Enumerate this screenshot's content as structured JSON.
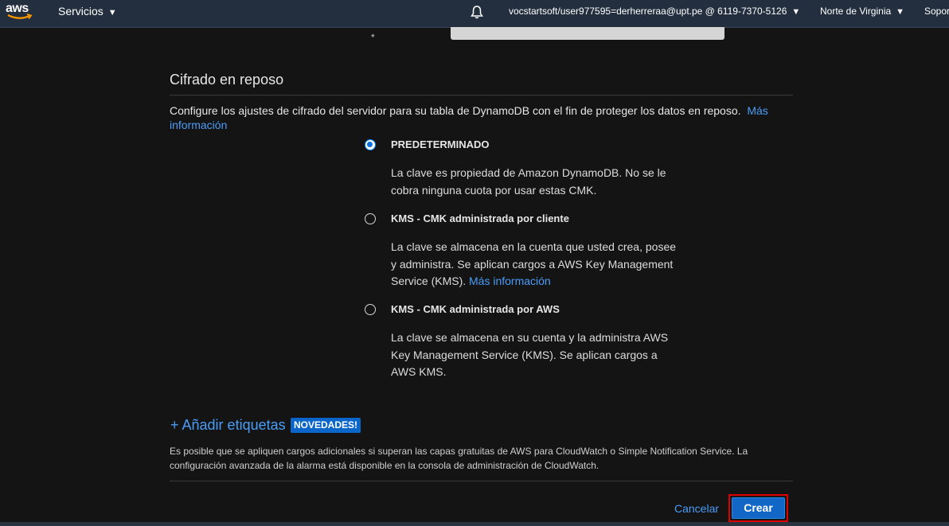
{
  "nav": {
    "logo_text": "aws",
    "services_label": "Servicios",
    "account_label": "vocstartsoft/user977595=derherreraa@upt.pe @ 6119-7370-5126",
    "region_label": "Norte de Virginia",
    "support_label": "Sopor"
  },
  "prev_field": {
    "required_marker": "*"
  },
  "encryption": {
    "title": "Cifrado en reposo",
    "description": "Configure los ajustes de cifrado del servidor para su tabla de DynamoDB con el fin de proteger los datos en reposo.",
    "more_info": "Más información",
    "options": [
      {
        "title": "PREDETERMINADO",
        "description": "La clave es propiedad de Amazon DynamoDB. No se le cobra ninguna cuota por usar estas CMK.",
        "selected": true
      },
      {
        "title": "KMS - CMK administrada por cliente",
        "description": "La clave se almacena en la cuenta que usted crea, posee y administra. Se aplican cargos a AWS Key Management Service (KMS).",
        "link": "Más información",
        "selected": false
      },
      {
        "title": "KMS - CMK administrada por AWS",
        "description": "La clave se almacena en su cuenta y la administra AWS Key Management Service (KMS). Se aplican cargos a AWS KMS.",
        "selected": false
      }
    ]
  },
  "tags": {
    "add_label": "+ Añadir etiquetas",
    "badge": "NOVEDADES!"
  },
  "note": "Es posible que se apliquen cargos adicionales si superan las capas gratuitas de AWS para CloudWatch o Simple Notification Service. La configuración avanzada de la alarma está disponible en la consola de administración de CloudWatch.",
  "footer": {
    "cancel_label": "Cancelar",
    "create_label": "Crear"
  },
  "colors": {
    "accent": "#4a9df7",
    "primary_button": "#1166c6",
    "highlight_border": "#e00000",
    "nav_bg": "#232f3e"
  }
}
